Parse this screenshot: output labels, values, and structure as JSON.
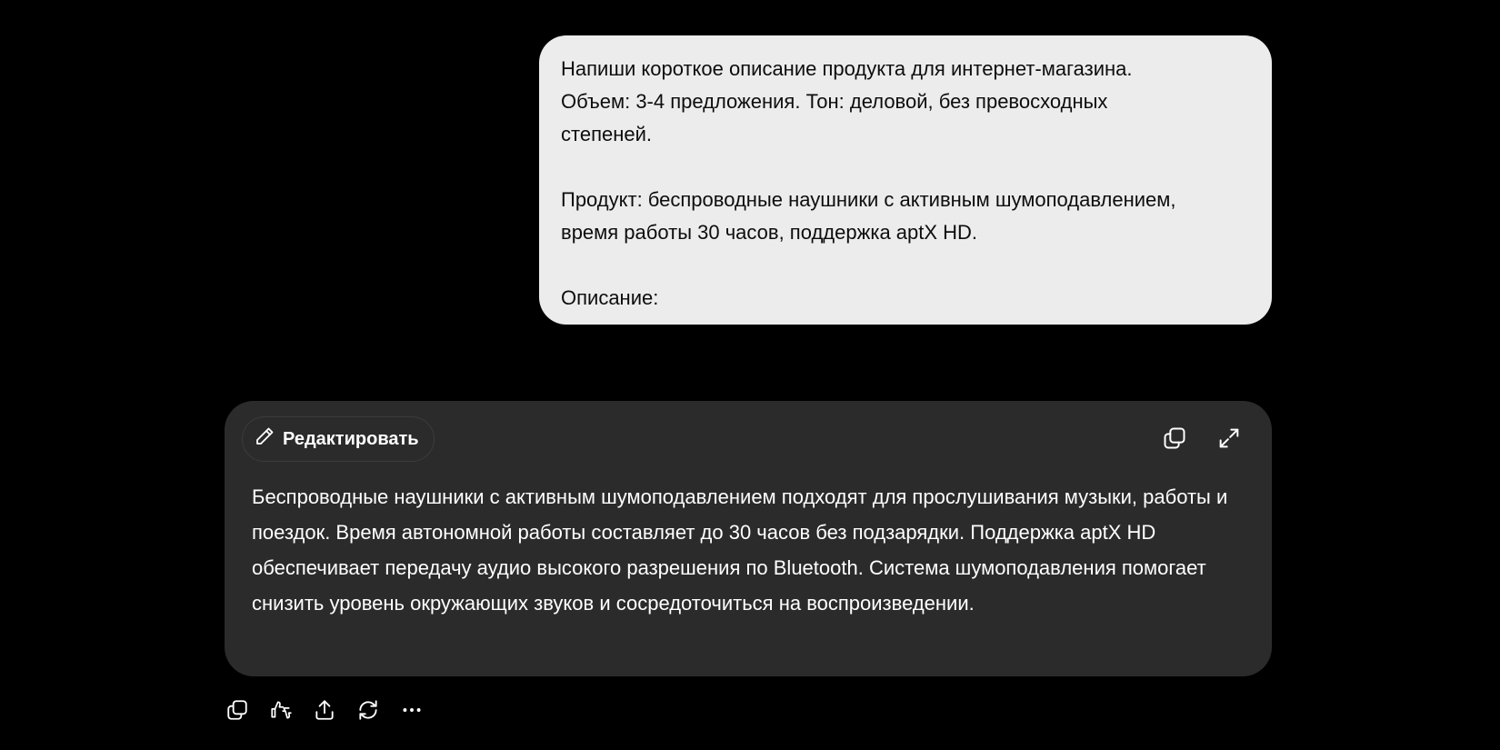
{
  "user_message": {
    "line1": "Напиши короткое описание продукта для интернет-магазина.",
    "line2": "Объем: 3-4 предложения. Тон: деловой, без превосходных",
    "line3": "степеней.",
    "line4": "Продукт: беспроводные наушники с активным шумоподавлением,",
    "line5": "время работы 30 часов, поддержка aptX HD.",
    "line6": "Описание:"
  },
  "canvas": {
    "edit_label": "Редактировать",
    "copy_icon": "copy-icon",
    "expand_icon": "expand-icon",
    "response": "Беспроводные наушники с активным шумоподавлением подходят для прослушивания музыки, работы и поездок. Время автономной работы составляет до 30 часов без подзарядки. Поддержка aptX HD обеспечивает передачу аудио высокого разрешения по Bluetooth. Система шумоподавления помогает снизить уровень окружающих звуков и сосредоточиться на воспроизведении."
  },
  "actions": {
    "icons": [
      "copy-icon",
      "thumbs-up-down-icon",
      "share-icon",
      "regenerate-icon",
      "more-icon"
    ]
  },
  "colors": {
    "background": "#000000",
    "user_bubble": "#ececec",
    "canvas_card": "#2b2b2b",
    "text_light": "#ffffff",
    "text_dark": "#0d0d0d"
  }
}
